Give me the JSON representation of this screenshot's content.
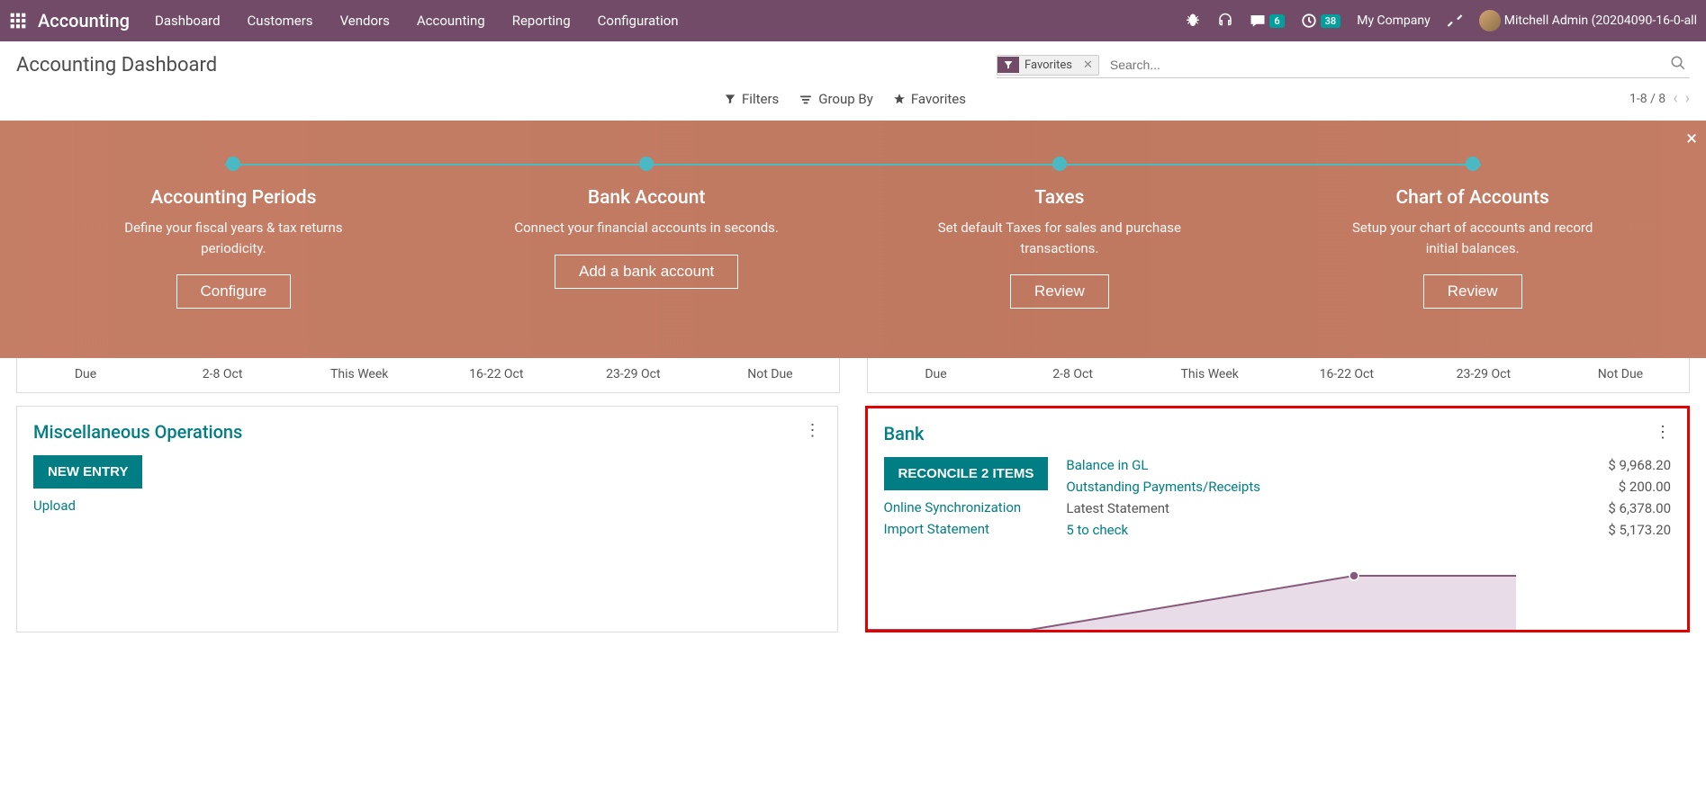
{
  "nav": {
    "app": "Accounting",
    "items": [
      "Dashboard",
      "Customers",
      "Vendors",
      "Accounting",
      "Reporting",
      "Configuration"
    ],
    "messages_badge": "6",
    "activities_badge": "38",
    "company": "My Company",
    "user": "Mitchell Admin (20204090-16-0-all"
  },
  "cp": {
    "title": "Accounting Dashboard",
    "facet_label": "Favorites",
    "search_placeholder": "Search...",
    "filters": "Filters",
    "groupby": "Group By",
    "favorites": "Favorites",
    "pager": "1-8 / 8"
  },
  "onboard": {
    "steps": [
      {
        "title": "Accounting Periods",
        "desc": "Define your fiscal years & tax returns periodicity.",
        "btn": "Configure"
      },
      {
        "title": "Bank Account",
        "desc": "Connect your financial accounts in seconds.",
        "btn": "Add a bank account"
      },
      {
        "title": "Taxes",
        "desc": "Set default Taxes for sales and purchase transactions.",
        "btn": "Review"
      },
      {
        "title": "Chart of Accounts",
        "desc": "Setup your chart of accounts and record initial balances.",
        "btn": "Review"
      }
    ]
  },
  "dates": [
    "Due",
    "2-8 Oct",
    "This Week",
    "16-22 Oct",
    "23-29 Oct",
    "Not Due"
  ],
  "misc": {
    "title": "Miscellaneous Operations",
    "new_entry": "NEW ENTRY",
    "upload": "Upload"
  },
  "bank": {
    "title": "Bank",
    "reconcile": "RECONCILE 2 ITEMS",
    "online_sync": "Online Synchronization",
    "import_stmt": "Import Statement",
    "rows": [
      {
        "label": "Balance in GL",
        "value": "$ 9,968.20",
        "link": true
      },
      {
        "label": "Outstanding Payments/Receipts",
        "value": "$ 200.00",
        "link": true
      },
      {
        "label": "Latest Statement",
        "value": "$ 6,378.00",
        "link": false
      },
      {
        "label": "5 to check",
        "value": "$ 5,173.20",
        "link": true
      }
    ]
  },
  "chart_data": {
    "type": "area",
    "x": [
      0,
      1,
      2,
      3,
      4
    ],
    "y": [
      0,
      0,
      30,
      60,
      60
    ],
    "ylim": [
      0,
      75
    ],
    "marker_index": 3
  }
}
